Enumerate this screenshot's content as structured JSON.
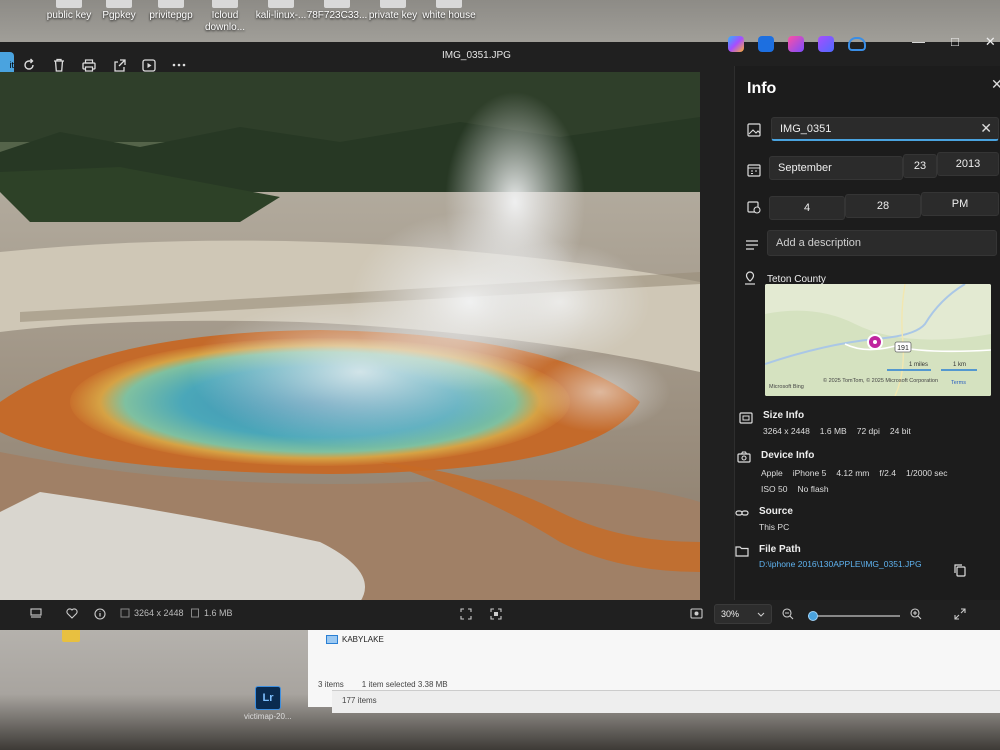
{
  "desktop": {
    "icons": [
      {
        "label": "public key"
      },
      {
        "label": "Pgpkey"
      },
      {
        "label": "privitepgp"
      },
      {
        "label": "Icloud downlo..."
      },
      {
        "label": "kali-linux-..."
      },
      {
        "label": "78F723C33..."
      },
      {
        "label": "private key"
      },
      {
        "label": "white house"
      }
    ],
    "explorer": {
      "drive_label": "KABYLAKE",
      "status_items": "3 items",
      "status_selected": "1 item selected  3.38 MB",
      "items_count": "177 items"
    },
    "app_label": "victimap-20..."
  },
  "window": {
    "title": "IMG_0351.JPG",
    "edit_label": "it"
  },
  "bottom_bar": {
    "dimensions": "3264 x 2448",
    "size": "1.6 MB",
    "zoom": "30%",
    "zoom_level": 0.05
  },
  "info": {
    "title": "Info",
    "name_value": "IMG_0351",
    "date": {
      "month": "September",
      "day": "23",
      "year": "2013"
    },
    "time": {
      "hour": "4",
      "minute": "28",
      "period": "PM"
    },
    "description_placeholder": "Add a description",
    "location": "Teton County",
    "map": {
      "route": "191",
      "scale_miles": "1 miles",
      "scale_km": "1 km",
      "brand": "Microsoft Bing",
      "copyright": "© 2025 TomTom, © 2025 Microsoft Corporation",
      "terms": "Terms"
    },
    "size_info": {
      "label": "Size Info",
      "dims": "3264 x 2448",
      "size": "1.6 MB",
      "dpi": "72 dpi",
      "bit": "24 bit"
    },
    "device_info": {
      "label": "Device Info",
      "make": "Apple",
      "model": "iPhone 5",
      "focal": "4.12 mm",
      "aperture": "f/2.4",
      "shutter": "1/2000 sec",
      "iso": "ISO 50",
      "flash": "No flash"
    },
    "source": {
      "label": "Source",
      "value": "This PC"
    },
    "file_path": {
      "label": "File Path",
      "value": "D:\\iphone 2016\\130APPLE\\IMG_0351.JPG"
    }
  },
  "colors": {
    "accent": "#4aa3df",
    "panel": "#1c1c1c",
    "window": "#202020"
  }
}
